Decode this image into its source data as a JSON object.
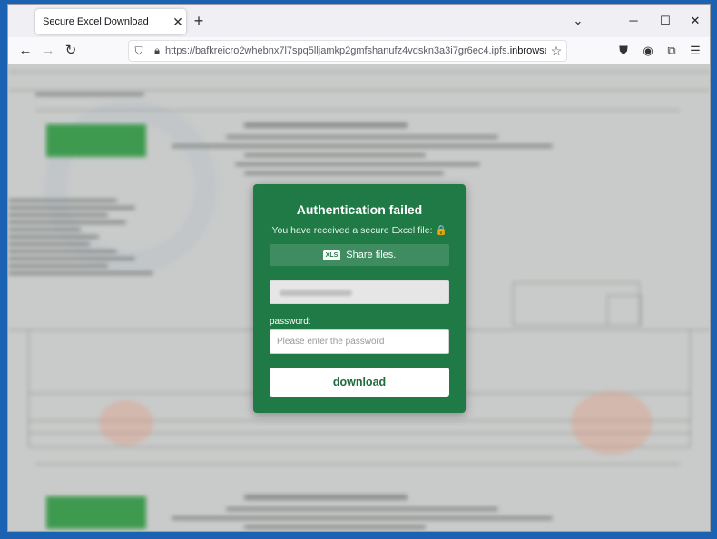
{
  "browser": {
    "tab_title": "Secure Excel Download",
    "tab_close": "✕",
    "new_tab": "+",
    "url_prefix": "https://bafkreicro2whebnx7l7spq5lljamkp2gmfshanufz4vdskn3a3i7gr6ec4.ipfs.",
    "url_domain": "inbrowser.link",
    "url_suffix": "/"
  },
  "modal": {
    "title": "Authentication failed",
    "subtitle": "You have received a secure Excel file:",
    "lock_glyph": "🔒",
    "file_badge": "XLS",
    "file_label": "Share files.",
    "password_label": "password:",
    "password_placeholder": "Please enter the password",
    "download_label": "download"
  },
  "colors": {
    "modal_bg": "#1f7a46",
    "page_bg": "#1c62b3"
  }
}
